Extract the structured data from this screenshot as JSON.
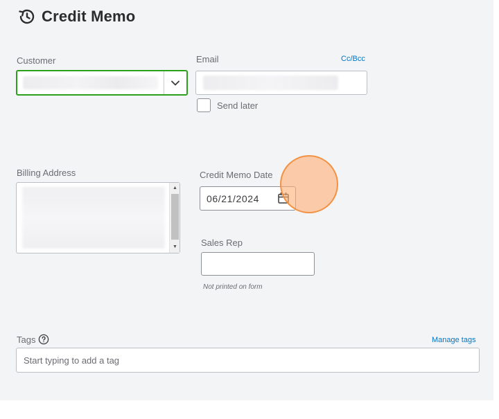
{
  "form": {
    "title": "Credit Memo",
    "customer_label": "Customer",
    "email_label": "Email",
    "cc_bcc_link": "Cc/Bcc",
    "send_later_label": "Send later",
    "billing_address_label": "Billing Address",
    "credit_memo_date_label": "Credit Memo Date",
    "credit_memo_date_value": "06/21/2024",
    "sales_rep_label": "Sales Rep",
    "sales_rep_value": "",
    "sales_rep_note": "Not printed on form",
    "tags_label": "Tags",
    "manage_tags_link": "Manage tags",
    "tags_placeholder": "Start typing to add a tag"
  },
  "icons": {
    "title_icon": "history-icon",
    "customer_dropdown": "chevron-down-icon",
    "date_picker": "calendar-icon",
    "tags_help": "help-icon"
  },
  "colors": {
    "accent_green": "#2ca01c",
    "link_blue": "#0077c5",
    "cursor_highlight": "#f5a05c"
  }
}
